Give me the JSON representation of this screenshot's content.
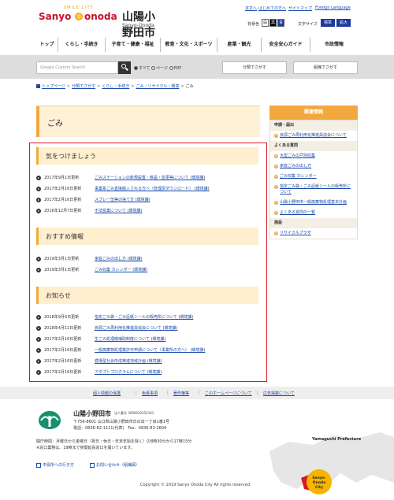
{
  "header": {
    "logo_sanyo": "Sanyo",
    "logo_onoda": "onoda",
    "logo_smile": "SMILE CITY",
    "site_name": "山陽小野田市",
    "site_name_en": "Sanyo-Onoda City",
    "top_links": [
      "本文へ",
      "はじめての方へ",
      "サイトマップ",
      "Foreign Language"
    ],
    "bg_color_label": "背景色",
    "bg_colors": [
      "白",
      "黒",
      "青"
    ],
    "font_size_label": "文字サイズ",
    "font_sizes": [
      "標準",
      "拡大"
    ]
  },
  "mainnav": [
    "トップ",
    "くらし・手続き",
    "子育て・健康・福祉",
    "教育・文化・スポーツ",
    "産業・観光",
    "安全安心ガイド",
    "市政情報"
  ],
  "search": {
    "placeholder": "Custom Search",
    "google_label": "Google",
    "options": [
      "すべて",
      "ページ",
      "PDF"
    ],
    "btn_category": "分類でさがす",
    "btn_org": "組織でさがす"
  },
  "breadcrumb": [
    "トップページ",
    "分類でさがす",
    "くらし・手続き",
    "ごみ・リサイクル・環境",
    "ごみ"
  ],
  "page_title": "ごみ",
  "sections": [
    {
      "heading": "気をつけましょう",
      "items": [
        {
          "date": "2017年9月1日更新",
          "title": "ごみステーションの新規設置・移設・変更等について",
          "dept": "環境課"
        },
        {
          "date": "2017年2月16日更新",
          "title": "事業系ごみ直接搬入される方へ（管理票ダウンロード）",
          "dept": "環境課"
        },
        {
          "date": "2017年2月16日更新",
          "title": "スプレー缶等の捨て方",
          "dept": "環境課"
        },
        {
          "date": "2016年12月7日更新",
          "title": "不法投棄について",
          "dept": "環境課"
        }
      ]
    },
    {
      "heading": "おすすめ情報",
      "items": [
        {
          "date": "2019年3月1日更新",
          "title": "家庭ごみの出し方",
          "dept": "環境課"
        },
        {
          "date": "2019年3月1日更新",
          "title": "ごみ収集 カレンダー",
          "dept": "環境課"
        }
      ]
    },
    {
      "heading": "お知らせ",
      "items": [
        {
          "date": "2018年9月6日更新",
          "title": "指定ごみ袋・ごみ証紙シールの販売所について",
          "dept": "環境課"
        },
        {
          "date": "2018年4月11日更新",
          "title": "資源ごみ再利用化推進員協会について",
          "dept": "環境課"
        },
        {
          "date": "2017年2月16日更新",
          "title": "生ごみ処理機補助制度について",
          "dept": "環境課"
        },
        {
          "date": "2017年2月16日更新",
          "title": "一般廃棄物処理業許可申請について（事業所の方へ）",
          "dept": "環境課"
        },
        {
          "date": "2017年2月16日更新",
          "title": "循環型社会形成推進地域計画",
          "dept": "環境課"
        },
        {
          "date": "2017年2月16日更新",
          "title": "アダプトプログラムについて",
          "dept": "環境課"
        }
      ]
    }
  ],
  "sidebar": {
    "heading": "関連情報",
    "groups": [
      {
        "title": "申請・届出",
        "links": [
          "資源ごみ再利用化推進員協会について"
        ]
      },
      {
        "title": "よくある質問",
        "links": [
          "大型ごみの戸別収集",
          "家庭ごみの出し方",
          "ごみ収集 カレンダー",
          "指定ごみ袋・ごみ証紙シールの販売所について",
          "山陽小野田市一般廃棄物処理基本計画",
          "よくある質問の一覧"
        ]
      },
      {
        "title": "施設",
        "links": [
          "リサイクルプラザ"
        ]
      }
    ]
  },
  "footer_links": [
    "個人情報の保護",
    "免責事項",
    "著作権等",
    "このホームページについて",
    "広告掲載について"
  ],
  "footer": {
    "name": "山陽小野田市",
    "corp_no": "法人番号 3000020352161",
    "address": "〒756-8601 山口県山陽小野田市日の出一丁目1番1号",
    "tel": "電話：0836-82-1111(代表)　Fax：0836-83-2604",
    "hours1": "開庁時間：月曜日から金曜日（祝日・休日・年末年始を除く）の8時30分から17時15分",
    "hours2": "※窓口業務は、19時まで夜間延長窓口を開いています。",
    "nav1": "市役所への行き方",
    "nav2": "お問い合わせ（組織図）",
    "copyright": "Copyright © 2019 Sanyo Onoda City All rights reserved.",
    "map_label": "Yamaguchi Prefecture",
    "city_badge": [
      "Sanyo-",
      "Onoda",
      "City"
    ]
  }
}
